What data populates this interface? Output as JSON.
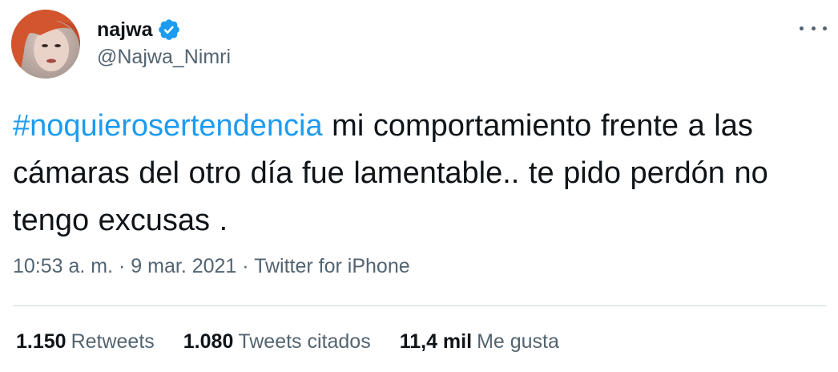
{
  "user": {
    "display_name": "najwa",
    "handle": "@Najwa_Nimri",
    "verified_icon": "verified-badge-icon",
    "avatar_icon": "profile-photo"
  },
  "more_icon": "more-options-icon",
  "tweet": {
    "hashtag": "#noquierosertendencia",
    "text": " mi comportamiento frente a las cámaras del otro día fue lamentable.. te pido perdón  no tengo excusas ."
  },
  "meta": {
    "time": "10:53 a. m.",
    "sep1": " · ",
    "date": "9 mar. 2021",
    "sep2": " · ",
    "source": "Twitter for iPhone"
  },
  "stats": [
    {
      "value": "1.150",
      "label": "Retweets"
    },
    {
      "value": "1.080",
      "label": "Tweets citados"
    },
    {
      "value": "11,4 mil",
      "label": "Me gusta"
    }
  ],
  "colors": {
    "accent": "#1d9bf0",
    "secondary_text": "#536471",
    "primary_text": "#0f1419",
    "divider": "#cfd9de"
  }
}
